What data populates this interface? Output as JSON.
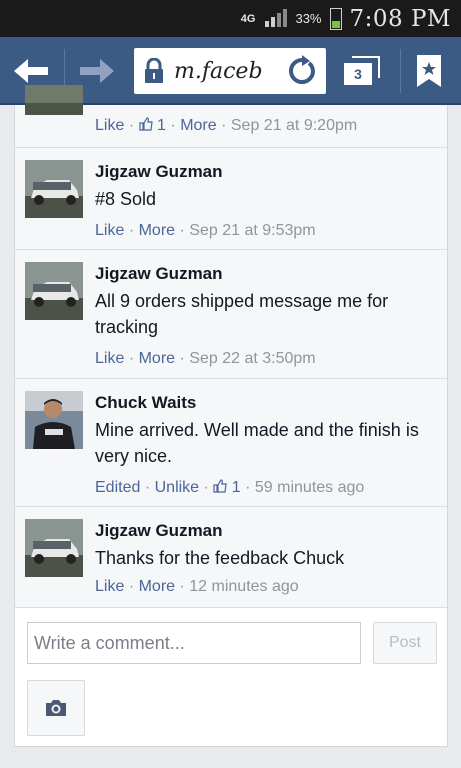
{
  "status_bar": {
    "data_icon": "4G",
    "signal_icon": "signal-icon",
    "battery_percent": "33%",
    "battery_level": 0.33,
    "time": "7:08 PM"
  },
  "browser": {
    "url": "m.faceb",
    "tabs_count": "3",
    "colors": {
      "toolbar": "#3b5a84",
      "link": "#4b6699"
    }
  },
  "comments": [
    {
      "author": "",
      "text": "",
      "actions": [
        "Like",
        "1",
        "More"
      ],
      "timestamp": "Sep 21 at 9:20pm",
      "likes": "1"
    },
    {
      "author": "Jigzaw Guzman",
      "text": "#8 Sold",
      "actions": [
        "Like",
        "More"
      ],
      "timestamp": "Sep 21 at 9:53pm"
    },
    {
      "author": "Jigzaw Guzman",
      "text": "All 9 orders shipped message me for tracking",
      "actions": [
        "Like",
        "More"
      ],
      "timestamp": "Sep 22 at 3:50pm"
    },
    {
      "author": "Chuck Waits",
      "text": "Mine arrived. Well made and the finish is very nice.",
      "actions": [
        "Edited",
        "Unlike",
        "1"
      ],
      "timestamp": "59 minutes ago",
      "likes": "1"
    },
    {
      "author": "Jigzaw Guzman",
      "text": "Thanks for the feedback Chuck",
      "actions": [
        "Like",
        "More"
      ],
      "timestamp": "12 minutes ago"
    }
  ],
  "composer": {
    "placeholder": "Write a comment...",
    "post_label": "Post",
    "camera_icon": "camera-icon"
  }
}
